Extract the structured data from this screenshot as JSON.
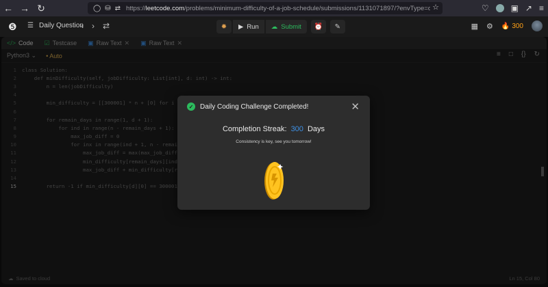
{
  "browser": {
    "url_prefix": "https://",
    "url_domain": "leetcode.com",
    "url_path": "/problems/minimum-difficulty-of-a-job-schedule/submissions/1131071897/?envType=daily-question&"
  },
  "header": {
    "daily_label": "Daily Question",
    "run_label": "Run",
    "submit_label": "Submit",
    "streak_count": "300"
  },
  "editor": {
    "tabs": [
      {
        "label": "Code"
      },
      {
        "label": "Testcase"
      },
      {
        "label": "Raw Text"
      },
      {
        "label": "Raw Text"
      }
    ],
    "language": "Python3",
    "auto_label": "Auto",
    "code_lines": [
      {
        "n": "1",
        "text": "class Solution:"
      },
      {
        "n": "2",
        "text": "    def minDifficulty(self, jobDifficulty: List[int], d: int) -> int:"
      },
      {
        "n": "3",
        "text": "        n = len(jobDifficulty)"
      },
      {
        "n": "4",
        "text": ""
      },
      {
        "n": "5",
        "text": "        min_difficulty = [[300001] * n + [0] for i in"
      },
      {
        "n": "6",
        "text": ""
      },
      {
        "n": "7",
        "text": "        for remain_days in range(1, d + 1):"
      },
      {
        "n": "8",
        "text": "            for ind in range(n - remain_days + 1):"
      },
      {
        "n": "9",
        "text": "                max_job_diff = 0"
      },
      {
        "n": "10",
        "text": "                for inx in range(ind + 1, n - remain_d"
      },
      {
        "n": "11",
        "text": "                    max_job_diff = max(max_job_diff, j"
      },
      {
        "n": "12",
        "text": "                    min_difficulty[remain_days][ind] ="
      },
      {
        "n": "13",
        "text": "                    max_job_diff + min_difficulty[rema"
      },
      {
        "n": "14",
        "text": ""
      },
      {
        "n": "15",
        "text": "        return -1 if min_difficulty[d][0] == 300001 e"
      }
    ],
    "status_left": "Saved to cloud",
    "status_right": "Ln 15, Col 80"
  },
  "modal": {
    "title": "Daily Coding Challenge Completed!",
    "streak_label": "Completion Streak:",
    "streak_value": "300",
    "streak_unit": "Days",
    "tagline": "Consistency is key, see you tomorrow!"
  },
  "colors": {
    "accent_green": "#2cbb5d",
    "accent_blue": "#3e91e6",
    "streak_orange": "#ffa116"
  }
}
